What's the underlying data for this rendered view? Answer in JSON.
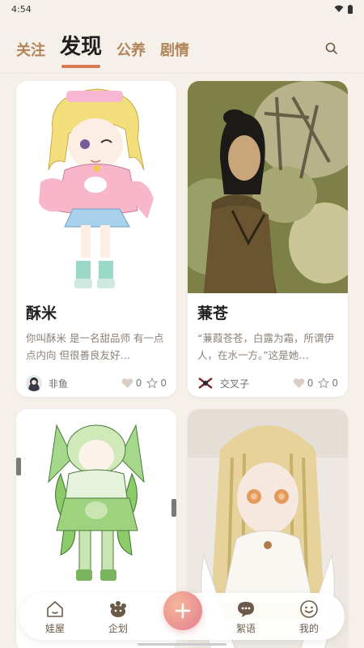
{
  "status_bar": {
    "time": "4:54"
  },
  "tabs": [
    {
      "label": "关注",
      "active": false
    },
    {
      "label": "发现",
      "active": true
    },
    {
      "label": "公养",
      "active": false
    },
    {
      "label": "剧情",
      "active": false
    }
  ],
  "cards": [
    {
      "title": "酥米",
      "desc": "你叫酥米 是一名甜品师 有一点点内向 但很善良友好…",
      "author": "非鱼",
      "likes": "0",
      "favorites": "0"
    },
    {
      "title": "蒹苍",
      "desc": "“蒹葭苍苍，白露为霜，所谓伊人，在水一方。”这是她…",
      "author": "交叉子",
      "likes": "0",
      "favorites": "0"
    },
    {
      "title": "",
      "desc": "",
      "author": "",
      "likes": "",
      "favorites": ""
    },
    {
      "title": "",
      "desc": "",
      "author": "",
      "likes": "",
      "favorites": ""
    }
  ],
  "nav": {
    "items": [
      {
        "label": "娃屋",
        "icon": "house-icon"
      },
      {
        "label": "企划",
        "icon": "pawprint-icon"
      },
      {
        "label": "",
        "icon": "plus-icon"
      },
      {
        "label": "絮语",
        "icon": "chat-icon"
      },
      {
        "label": "我的",
        "icon": "smile-icon"
      }
    ]
  },
  "colors": {
    "background": "#f5f0e9",
    "accent": "#d97a53",
    "tab_inactive": "#b18458"
  }
}
